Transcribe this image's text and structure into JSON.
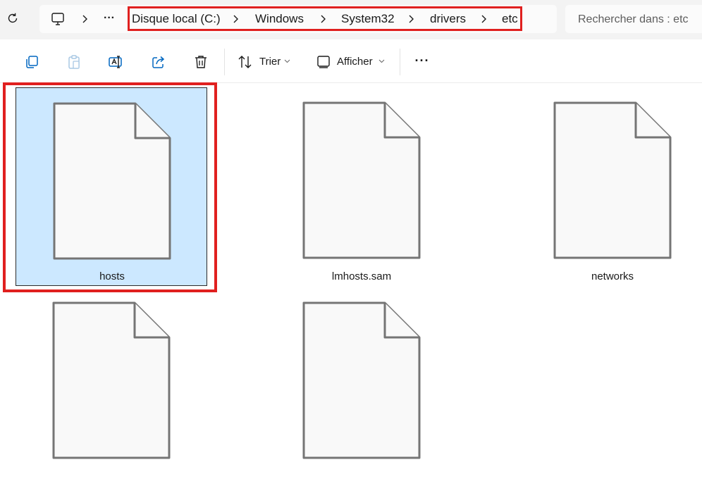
{
  "address_bar": {
    "breadcrumbs": [
      "Disque local (C:)",
      "Windows",
      "System32",
      "drivers",
      "etc"
    ],
    "overflow_label": "···"
  },
  "search": {
    "placeholder": "Rechercher dans : etc"
  },
  "toolbar": {
    "sort_label": "Trier",
    "view_label": "Afficher",
    "more_label": "···"
  },
  "files": [
    {
      "name": "hosts",
      "selected": true
    },
    {
      "name": "lmhosts.sam",
      "selected": false
    },
    {
      "name": "networks",
      "selected": false
    },
    {
      "name": "",
      "selected": false
    },
    {
      "name": "",
      "selected": false
    }
  ],
  "colors": {
    "highlight": "#e0201f",
    "selection": "#cce8ff",
    "file_outline": "#757575",
    "file_fill": "#f9f9f9"
  },
  "icons": [
    "refresh-icon",
    "this-pc-icon",
    "chevron-right-icon",
    "copy-icon",
    "paste-icon",
    "rename-icon",
    "share-icon",
    "delete-icon",
    "sort-icon",
    "view-icon",
    "chevron-down-icon",
    "file-icon"
  ]
}
